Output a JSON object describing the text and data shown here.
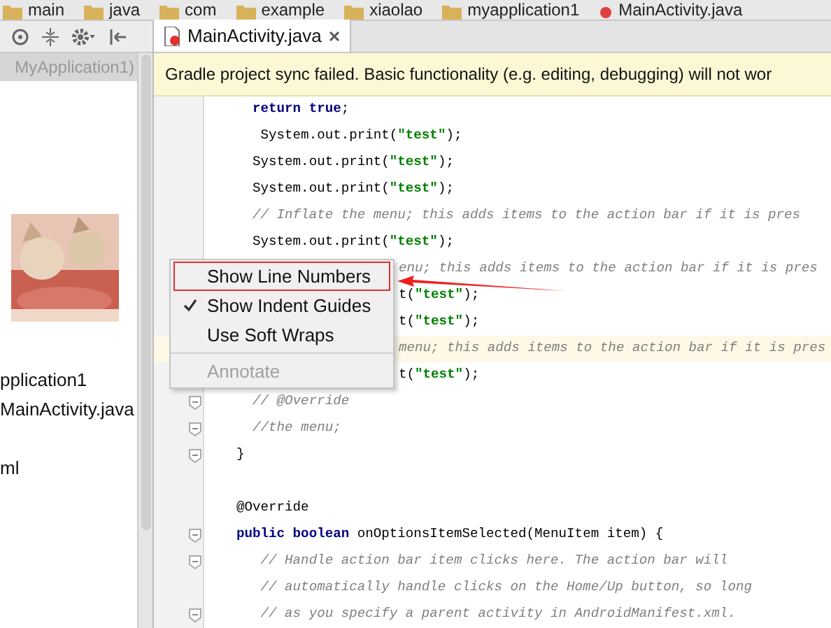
{
  "breadcrumbs": [
    "main",
    "java",
    "com",
    "example",
    "xiaolao",
    "myapplication1",
    "MainActivity.java"
  ],
  "project_panel": {
    "header": "MyApplication1)",
    "items": [
      "pplication1",
      "MainActivity.java",
      "ml"
    ]
  },
  "editor_tab": {
    "label": "MainActivity.java",
    "selected": true
  },
  "banner": "Gradle project sync failed. Basic functionality (e.g. editing, debugging) will not wor",
  "code_lines": [
    {
      "kind": "code",
      "fold_marker": false,
      "current": false,
      "tokens": [
        {
          "text": "  return true",
          "kind": "keyword"
        },
        {
          "text": ";",
          "kind": "plain"
        }
      ]
    },
    {
      "kind": "code",
      "fold_marker": false,
      "current": false,
      "tokens": [
        {
          "text": "   System.out.print(",
          "kind": "plain"
        },
        {
          "text": "\"test\"",
          "kind": "string"
        },
        {
          "text": ");",
          "kind": "plain"
        }
      ]
    },
    {
      "kind": "code",
      "fold_marker": false,
      "current": false,
      "tokens": [
        {
          "text": "  System.out.print(",
          "kind": "plain"
        },
        {
          "text": "\"test\"",
          "kind": "string"
        },
        {
          "text": ");",
          "kind": "plain"
        }
      ]
    },
    {
      "kind": "code",
      "fold_marker": false,
      "current": false,
      "tokens": [
        {
          "text": "  System.out.print(",
          "kind": "plain"
        },
        {
          "text": "\"test\"",
          "kind": "string"
        },
        {
          "text": ");",
          "kind": "plain"
        }
      ]
    },
    {
      "kind": "code",
      "fold_marker": false,
      "current": false,
      "tokens": [
        {
          "text": "  // Inflate the menu; this adds items to the action bar if it is pres",
          "kind": "comment"
        }
      ]
    },
    {
      "kind": "code",
      "fold_marker": false,
      "current": false,
      "tokens": [
        {
          "text": "  System.out.print(",
          "kind": "plain"
        },
        {
          "text": "\"test\"",
          "kind": "string"
        },
        {
          "text": ");",
          "kind": "plain"
        }
      ]
    },
    {
      "kind": "covered",
      "current": false,
      "tokens": [
        {
          "text": "enu; this adds items to the action bar if it is pres",
          "kind": "comment"
        }
      ]
    },
    {
      "kind": "covered",
      "current": false,
      "tokens": [
        {
          "text": "t(",
          "kind": "plain"
        },
        {
          "text": "\"test\"",
          "kind": "string"
        },
        {
          "text": ");",
          "kind": "plain"
        }
      ]
    },
    {
      "kind": "covered",
      "current": false,
      "tokens": [
        {
          "text": "t(",
          "kind": "plain"
        },
        {
          "text": "\"test\"",
          "kind": "string"
        },
        {
          "text": ");",
          "kind": "plain"
        }
      ]
    },
    {
      "kind": "covered",
      "current": true,
      "tokens": [
        {
          "text": "menu; this adds items to the action bar if it is pres",
          "kind": "comment"
        }
      ]
    },
    {
      "kind": "covered",
      "current": false,
      "tokens": [
        {
          "text": "t(",
          "kind": "plain"
        },
        {
          "text": "\"test\"",
          "kind": "string"
        },
        {
          "text": ");",
          "kind": "plain"
        }
      ]
    },
    {
      "kind": "code",
      "fold_marker": true,
      "current": false,
      "tokens": [
        {
          "text": "  // @Override",
          "kind": "comment"
        }
      ]
    },
    {
      "kind": "code",
      "fold_marker": true,
      "current": false,
      "tokens": [
        {
          "text": "  //the menu;",
          "kind": "comment"
        }
      ]
    },
    {
      "kind": "code",
      "fold_marker": true,
      "current": false,
      "tokens": [
        {
          "text": "}",
          "kind": "plain"
        }
      ]
    },
    {
      "kind": "blank",
      "fold_marker": false
    },
    {
      "kind": "code",
      "fold_marker": false,
      "current": false,
      "tokens": [
        {
          "text": "@Override",
          "kind": "plain"
        }
      ]
    },
    {
      "kind": "code",
      "fold_marker": true,
      "current": false,
      "tokens": [
        {
          "text": "public boolean",
          "kind": "keyword"
        },
        {
          "text": " onOptionsItemSelected(MenuItem item) {",
          "kind": "plain"
        }
      ]
    },
    {
      "kind": "code",
      "fold_marker": true,
      "current": false,
      "tokens": [
        {
          "text": "   // Handle action bar item clicks here. The action bar will",
          "kind": "comment"
        }
      ]
    },
    {
      "kind": "code",
      "fold_marker": false,
      "current": false,
      "tokens": [
        {
          "text": "   // automatically handle clicks on the Home/Up button, so long",
          "kind": "comment"
        }
      ]
    },
    {
      "kind": "code",
      "fold_marker": true,
      "current": false,
      "tokens": [
        {
          "text": "   // as you specify a parent activity in AndroidManifest.xml.",
          "kind": "comment"
        }
      ]
    }
  ],
  "context_menu": {
    "items": [
      {
        "kind": "item",
        "label": "Show Line Numbers",
        "checked": false,
        "disabled": false,
        "marked": true
      },
      {
        "kind": "item",
        "label": "Show Indent Guides",
        "checked": true,
        "disabled": false,
        "marked": false
      },
      {
        "kind": "item",
        "label": "Use Soft Wraps",
        "checked": false,
        "disabled": false,
        "marked": false
      },
      {
        "kind": "separator"
      },
      {
        "kind": "item",
        "label": "Annotate",
        "checked": false,
        "disabled": true,
        "marked": false
      }
    ]
  }
}
